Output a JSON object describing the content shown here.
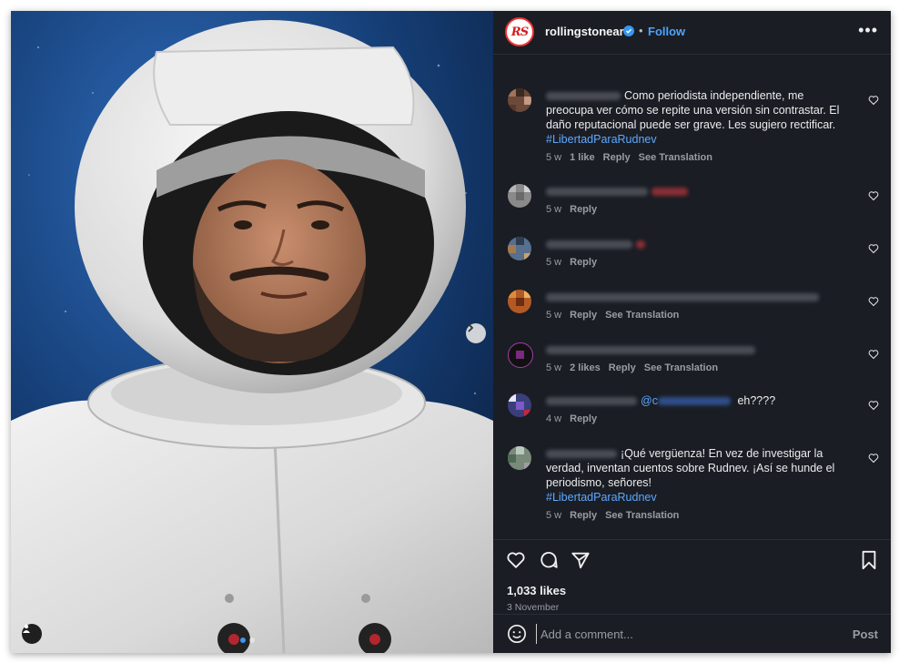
{
  "post": {
    "username": "rollingstonear",
    "avatar_text": "RS",
    "follow_label": "Follow",
    "separator": "•",
    "more_label": "•••"
  },
  "comments": [
    {
      "text": "Como periodista independiente, me preocupa ver cómo se repite una versión sin contrastar. El daño reputacional puede ser grave. Les sugiero rectificar.",
      "hashtag": "#LibertadParaRudnev",
      "time": "5 w",
      "likes": "1 like",
      "reply": "Reply",
      "translate": "See Translation"
    },
    {
      "time": "5 w",
      "reply": "Reply"
    },
    {
      "time": "5 w",
      "reply": "Reply"
    },
    {
      "time": "5 w",
      "reply": "Reply",
      "translate": "See Translation"
    },
    {
      "time": "5 w",
      "likes": "2 likes",
      "reply": "Reply",
      "translate": "See Translation"
    },
    {
      "mention": "@c",
      "text": "eh????",
      "time": "4 w",
      "reply": "Reply"
    },
    {
      "text": "¡Qué vergüenza! En vez de investigar la verdad, inventan cuentos sobre Rudnev. ¡Así se hunde el periodismo, señores!",
      "hashtag": "#LibertadParaRudnev",
      "time": "5 w",
      "reply": "Reply",
      "translate": "See Translation"
    }
  ],
  "footer": {
    "likes": "1,033 likes",
    "date": "3 November",
    "comment_placeholder": "Add a comment...",
    "post_label": "Post"
  },
  "colors": {
    "panel_bg": "#1a1d24",
    "link_blue": "#4da3ff",
    "verified": "#3897f0",
    "brand_red": "#d21e1e"
  },
  "icons": [
    "verified-icon",
    "more-icon",
    "heart-icon",
    "comment-icon",
    "share-icon",
    "bookmark-icon",
    "emoji-icon",
    "chevron-right-icon",
    "user-tag-icon"
  ]
}
